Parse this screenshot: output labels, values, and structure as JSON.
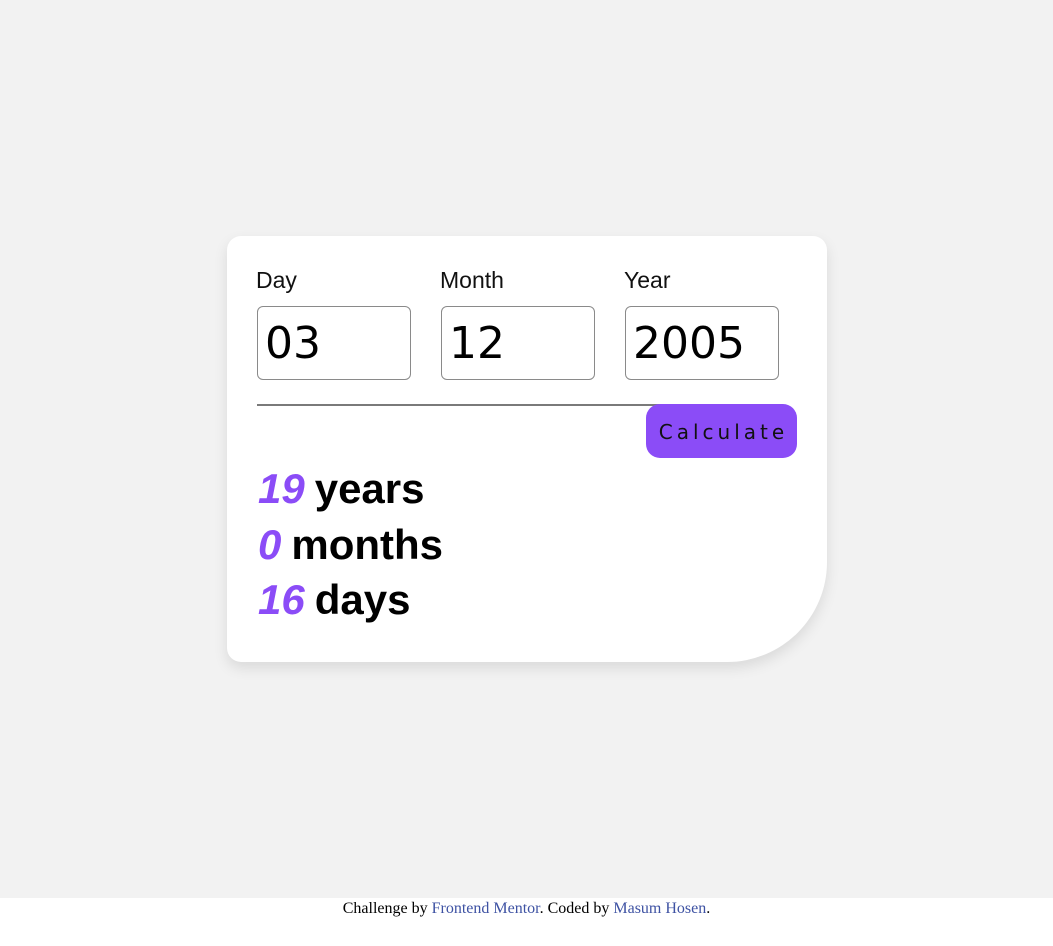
{
  "form": {
    "day": {
      "label": "Day",
      "value": "03"
    },
    "month": {
      "label": "Month",
      "value": "12"
    },
    "year": {
      "label": "Year",
      "value": "2005"
    },
    "calculate_label": "Calculate"
  },
  "results": {
    "years": {
      "value": "19",
      "unit": "years"
    },
    "months": {
      "value": "0",
      "unit": "months"
    },
    "days": {
      "value": "16",
      "unit": "days"
    }
  },
  "footer": {
    "prefix": "Challenge by ",
    "challenge_link": "Frontend Mentor",
    "middle": ". Coded by ",
    "author_link": "Masum Hosen",
    "suffix": "."
  },
  "colors": {
    "accent": "#8b4cf7",
    "background": "#f2f2f2",
    "card": "#ffffff",
    "link": "#3e52a3"
  }
}
